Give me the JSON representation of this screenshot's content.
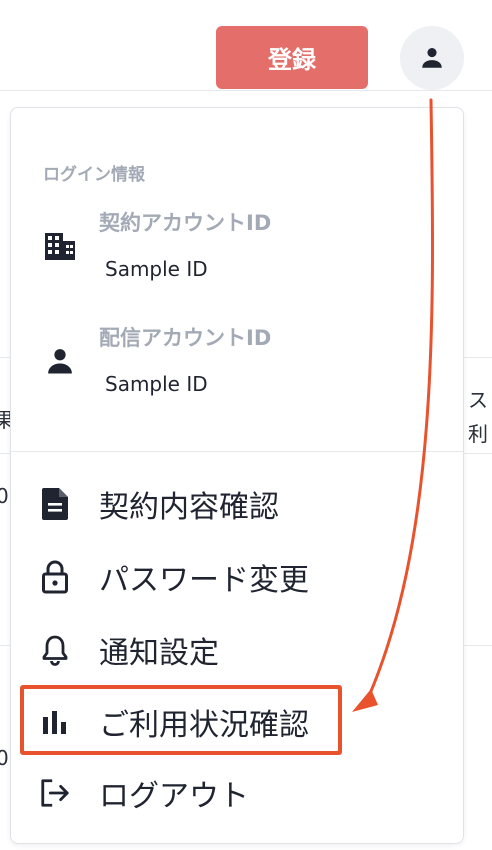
{
  "header": {
    "register_label": "登録"
  },
  "background": {
    "right_text_1": "ス",
    "right_text_2": "利",
    "left_fragment_1": "果",
    "left_fragment_2": "0",
    "left_fragment_3": "0"
  },
  "login_info": {
    "title": "ログイン情報",
    "contract_account": {
      "label": "契約アカウントID",
      "value": "Sample ID",
      "icon": "building-icon"
    },
    "delivery_account": {
      "label": "配信アカウントID",
      "value": "Sample ID",
      "icon": "person-icon"
    }
  },
  "menu": [
    {
      "label": "契約内容確認",
      "icon": "document-icon"
    },
    {
      "label": "パスワード変更",
      "icon": "lock-icon"
    },
    {
      "label": "通知設定",
      "icon": "bell-icon"
    },
    {
      "label": "ご利用状況確認",
      "icon": "bar-chart-icon"
    },
    {
      "label": "ログアウト",
      "icon": "logout-icon"
    }
  ],
  "colors": {
    "register_button": "#e46f6a",
    "annotation": "#e8532e",
    "muted_text": "#a3aab6"
  }
}
